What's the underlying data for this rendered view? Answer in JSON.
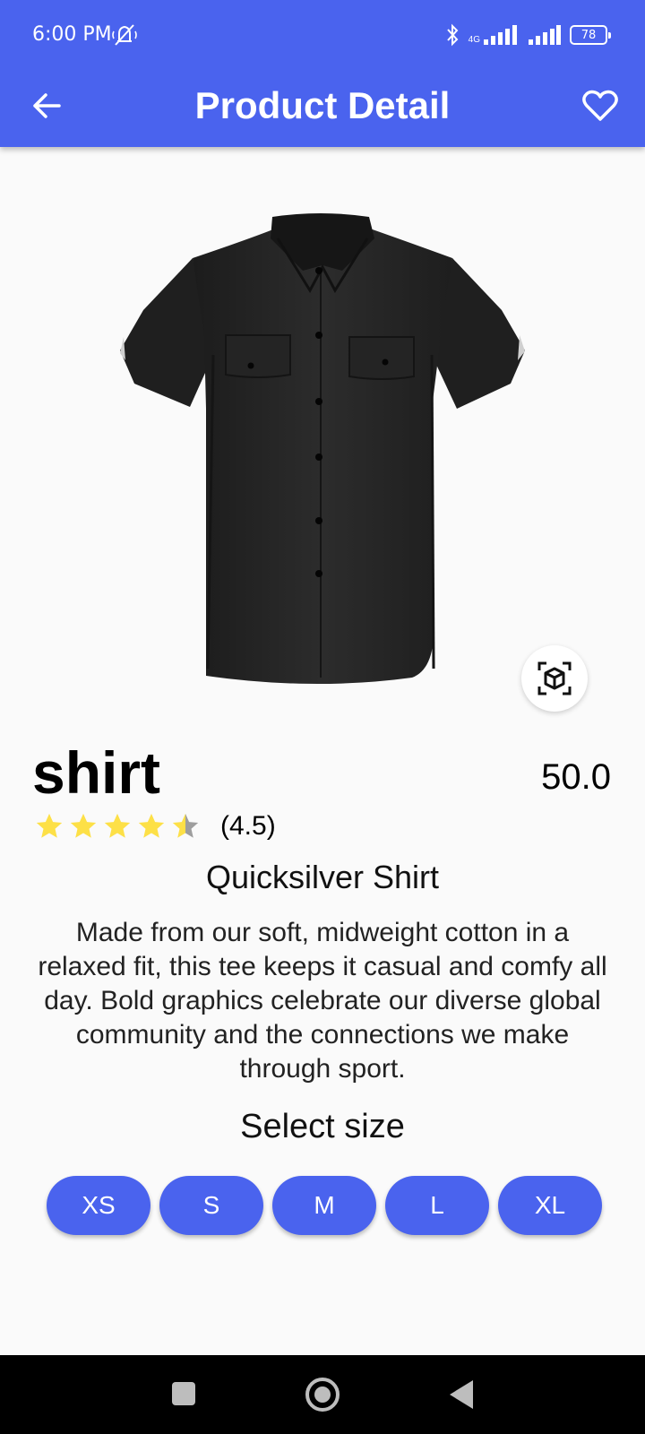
{
  "status_bar": {
    "time": "6:00 PM",
    "network": "4G",
    "battery": "78",
    "icons": [
      "mute-icon",
      "bluetooth-icon",
      "signal-icon",
      "signal-icon",
      "battery-icon"
    ]
  },
  "app_bar": {
    "title": "Product Detail",
    "back_icon": "arrow-left-icon",
    "favorite_icon": "heart-outline-icon"
  },
  "colors": {
    "primary": "#4a63ee",
    "star": "#fde047",
    "star_empty": "#9e9e9e",
    "background": "#fafafa"
  },
  "product": {
    "image_icon": "shirt-image",
    "ar_icon": "view-in-ar-icon",
    "name": "shirt",
    "price": "50.0",
    "rating": 4.5,
    "rating_text": "(4.5)",
    "subtitle": "Quicksilver Shirt",
    "description": "Made from our soft, midweight cotton in a relaxed fit, this tee keeps it casual and comfy all day. Bold graphics celebrate our diverse global community and the connections we make through sport."
  },
  "size_section": {
    "label": "Select size",
    "sizes": [
      "XS",
      "S",
      "M",
      "L",
      "XL"
    ]
  },
  "nav_bar": {
    "icons": [
      "recent-apps-icon",
      "home-icon",
      "back-icon"
    ]
  }
}
